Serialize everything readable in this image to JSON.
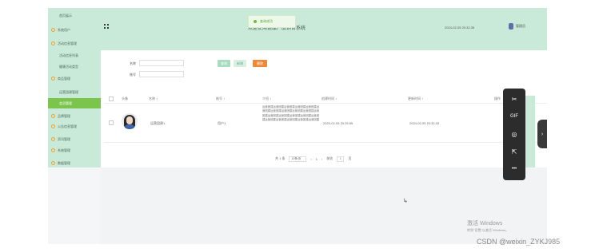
{
  "sidebar": {
    "items": [
      {
        "label": "首页展示",
        "sub": true
      },
      {
        "label": "系统用户",
        "sub": false
      },
      {
        "label": "活动信息管理",
        "sub": false
      },
      {
        "label": "活动信息列表",
        "sub": true
      },
      {
        "label": "健康活动类型",
        "sub": true
      },
      {
        "label": "商品管理",
        "sub": false
      },
      {
        "label": "运营团建管理",
        "sub": true
      },
      {
        "label": "会员管理",
        "sub": true
      },
      {
        "label": "品牌管理",
        "sub": false
      },
      {
        "label": "公告信息管理",
        "sub": false
      },
      {
        "label": "资讯管理",
        "sub": false
      },
      {
        "label": "系统管理",
        "sub": false
      },
      {
        "label": "数据管理",
        "sub": false
      }
    ],
    "active_index": 7
  },
  "header": {
    "title": "欢迎使用健康产品销售系统",
    "datetime": "2024-02-05 20:32:35",
    "user": "管理员"
  },
  "toast": {
    "message": "查询成功"
  },
  "filters": {
    "name_label": "名称",
    "account_label": "账号",
    "search_button": "查询",
    "add_button": "新增",
    "delete_button": "删除"
  },
  "table": {
    "headers": [
      "头像",
      "名称 ↕",
      "账号 ↕",
      "介绍 ↕",
      "创建时间 ↕",
      "更新时间 ↕",
      "操作"
    ],
    "rows": [
      {
        "name": "运营团建1",
        "account": "用户1",
        "intro": "运营团建运营团建运营团建运营团建运营团建运营团建运营团建运营团建运营团建运营团建运营团建运营团建运营团建运营团建运营团建运营团建运营团建运营团建运营团建运营团建运营团建",
        "created": "2024-02-05 20:25:55",
        "updated": "2024-02-05 20:32:33"
      }
    ]
  },
  "pager": {
    "total": "共 1 条",
    "page_size": "10条/页",
    "prev": "‹",
    "page": "1",
    "next": "›",
    "goto_label": "前往",
    "goto_value": "1",
    "goto_suffix": "页"
  },
  "watermark": {
    "line1": "激活 Windows",
    "line2": "转到\"设置\"以激活 Windows。"
  },
  "toolbar": {
    "icons": [
      "scissors-icon",
      "gif-icon",
      "record-icon",
      "share-icon",
      "more-icon"
    ],
    "glyphs": [
      "✂",
      "GIF",
      "◎",
      "⇱",
      "•••"
    ]
  },
  "side_tab": {
    "glyph": "›"
  },
  "credit": "CSDN @weixin_ZYKJ985"
}
